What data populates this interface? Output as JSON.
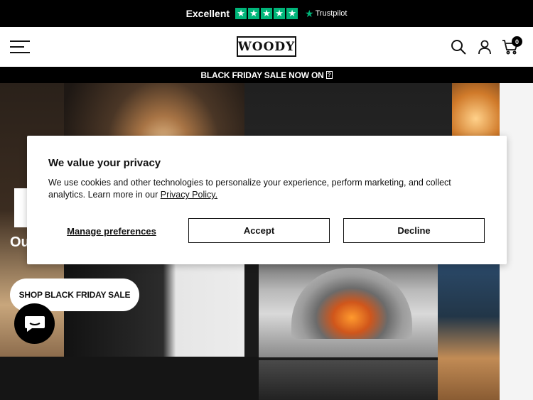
{
  "trustbar": {
    "rating_text": "Excellent",
    "stars": 5,
    "brand": "Trustpilot",
    "accent_color": "#00b67a"
  },
  "header": {
    "logo_text": "WOODY",
    "icons": [
      "menu-icon",
      "search-icon",
      "user-icon",
      "cart-icon"
    ],
    "cart_count": "0"
  },
  "announcement": {
    "text": "BLACK FRIDAY SALE NOW ON"
  },
  "hero": {
    "subtitle_fragment": "Ou",
    "cta_label": "SHOP BLACK FRIDAY SALE",
    "chat_icon": "chat-icon"
  },
  "privacy": {
    "title": "We value your privacy",
    "body": "We use cookies and other technologies to personalize your experience, perform marketing, and collect analytics. Learn more in our",
    "link_text": "Privacy Policy.",
    "manage_label": "Manage preferences",
    "accept_label": "Accept",
    "decline_label": "Decline"
  }
}
